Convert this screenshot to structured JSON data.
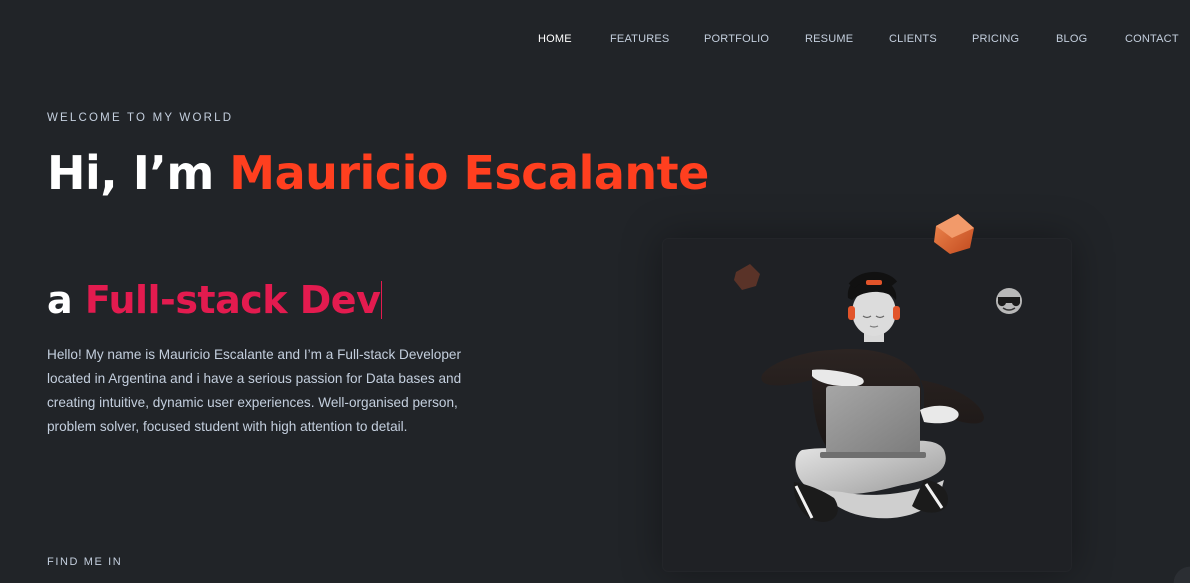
{
  "nav": {
    "items": [
      {
        "label": "HOME",
        "active": true
      },
      {
        "label": "FEATURES"
      },
      {
        "label": "PORTFOLIO"
      },
      {
        "label": "RESUME"
      },
      {
        "label": "CLIENTS"
      },
      {
        "label": "PRICING"
      },
      {
        "label": "BLOG"
      },
      {
        "label": "CONTACT"
      }
    ]
  },
  "hero": {
    "welcome": "WELCOME TO MY WORLD",
    "greeting": "Hi, I’m ",
    "name": "Mauricio Escalante",
    "article": "a ",
    "role": "Full-stack Dev",
    "intro": "Hello! My name is Mauricio Escalante and I’m a Full-stack Developer located in Argentina and i have a serious passion for Data bases and creating intuitive, dynamic user experiences. Well-organised person, problem solver, focused student with high attention to detail.",
    "find_me": "FIND ME IN"
  },
  "colors": {
    "background": "#212428",
    "accent_orange": "#ff3f1f",
    "accent_crimson": "#e31b4f",
    "text": "#c4cfde"
  },
  "icons": [
    "developer-illustration",
    "sunglasses-emoji-icon",
    "cube-icon"
  ]
}
